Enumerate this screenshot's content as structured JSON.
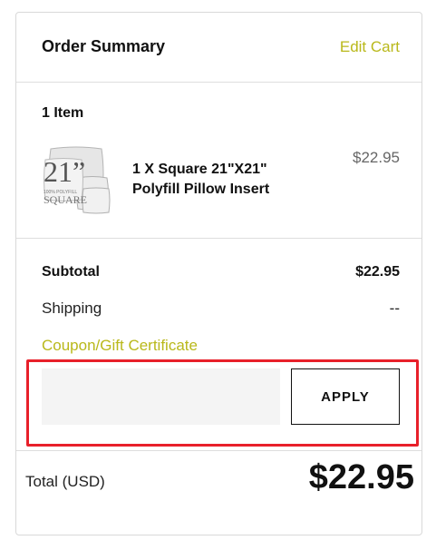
{
  "header": {
    "title": "Order Summary",
    "edit_link": "Edit Cart"
  },
  "items": {
    "count_label": "1 Item",
    "list": [
      {
        "name": "1 X Square 21\"X21\" Polyfill Pillow Insert",
        "price": "$22.95",
        "thumb": {
          "size_text": "21”",
          "small_text": "100% POLYFILL",
          "shape_text": "SQUARE"
        }
      }
    ]
  },
  "totals": {
    "subtotal_label": "Subtotal",
    "subtotal_value": "$22.95",
    "shipping_label": "Shipping",
    "shipping_value": "--",
    "coupon_label": "Coupon/Gift Certificate",
    "coupon_input_value": "",
    "apply_label": "APPLY"
  },
  "grand_total": {
    "label": "Total (USD)",
    "value": "$22.95"
  },
  "colors": {
    "accent": "#b9b81a",
    "highlight": "#e8202a",
    "input_bg": "#f4f4f4"
  }
}
